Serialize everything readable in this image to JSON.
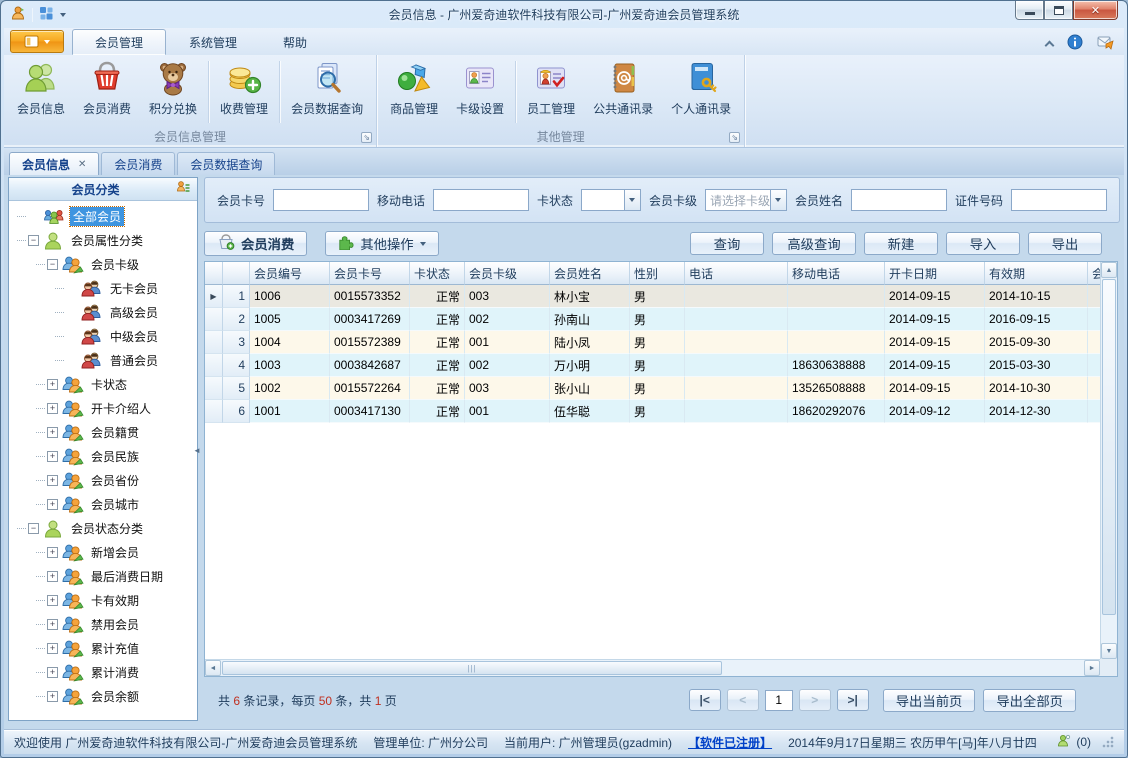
{
  "colors": {
    "accent_orange": "#f7a61f",
    "selection_blue": "#3e95e0",
    "row_cyan": "#e0f4fa",
    "row_cream": "#fdf8ea",
    "row_selected": "#eae8e0",
    "link_blue": "#0040c8",
    "number_red": "#c03020"
  },
  "glyphs": {
    "close": "✕",
    "tab_close": "✕",
    "dropdown": "▼",
    "row_marker": "▶",
    "scroll_left": "◄",
    "scroll_right": "►",
    "scroll_up": "▲",
    "scroll_down": "▼",
    "collapse_sidebar": "◄",
    "plus": "+",
    "minus": "−",
    "launcher": "⇘"
  },
  "title_bar": {
    "title": "会员信息 - 广州爱奇迪软件科技有限公司-广州爱奇迪会员管理系统"
  },
  "ribbon": {
    "tabs": [
      "会员管理",
      "系统管理",
      "帮助"
    ],
    "groups": [
      {
        "label": "会员信息管理",
        "buttons": [
          "会员信息",
          "会员消费",
          "积分兑换",
          "收费管理",
          "会员数据查询"
        ]
      },
      {
        "label": "其他管理",
        "buttons": [
          "商品管理",
          "卡级设置",
          "员工管理",
          "公共通讯录",
          "个人通讯录"
        ]
      }
    ]
  },
  "doc_tabs": [
    "会员信息",
    "会员消费",
    "会员数据查询"
  ],
  "sidebar": {
    "title": "会员分类",
    "tree": [
      {
        "label": "全部会员",
        "level": 0,
        "icon": "group",
        "expander": "none",
        "selected": true
      },
      {
        "label": "会员属性分类",
        "level": 0,
        "icon": "person",
        "expander": "minus"
      },
      {
        "label": "会员卡级",
        "level": 1,
        "icon": "pair_orange",
        "expander": "minus"
      },
      {
        "label": "无卡会员",
        "level": 2,
        "icon": "pair_red",
        "expander": "none"
      },
      {
        "label": "高级会员",
        "level": 2,
        "icon": "pair_red",
        "expander": "none"
      },
      {
        "label": "中级会员",
        "level": 2,
        "icon": "pair_red",
        "expander": "none"
      },
      {
        "label": "普通会员",
        "level": 2,
        "icon": "pair_red",
        "expander": "none"
      },
      {
        "label": "卡状态",
        "level": 1,
        "icon": "pair_orange",
        "expander": "plus"
      },
      {
        "label": "开卡介绍人",
        "level": 1,
        "icon": "pair_orange",
        "expander": "plus"
      },
      {
        "label": "会员籍贯",
        "level": 1,
        "icon": "pair_orange",
        "expander": "plus"
      },
      {
        "label": "会员民族",
        "level": 1,
        "icon": "pair_orange",
        "expander": "plus"
      },
      {
        "label": "会员省份",
        "level": 1,
        "icon": "pair_orange",
        "expander": "plus"
      },
      {
        "label": "会员城市",
        "level": 1,
        "icon": "pair_orange",
        "expander": "plus"
      },
      {
        "label": "会员状态分类",
        "level": 0,
        "icon": "person",
        "expander": "minus"
      },
      {
        "label": "新增会员",
        "level": 1,
        "icon": "pair_orange",
        "expander": "plus"
      },
      {
        "label": "最后消费日期",
        "level": 1,
        "icon": "pair_orange",
        "expander": "plus"
      },
      {
        "label": "卡有效期",
        "level": 1,
        "icon": "pair_orange",
        "expander": "plus"
      },
      {
        "label": "禁用会员",
        "level": 1,
        "icon": "pair_orange",
        "expander": "plus"
      },
      {
        "label": "累计充值",
        "level": 1,
        "icon": "pair_orange",
        "expander": "plus"
      },
      {
        "label": "累计消费",
        "level": 1,
        "icon": "pair_orange",
        "expander": "plus"
      },
      {
        "label": "会员余额",
        "level": 1,
        "icon": "pair_orange",
        "expander": "plus"
      }
    ]
  },
  "filters": {
    "card_no_label": "会员卡号",
    "mobile_label": "移动电话",
    "card_status_label": "卡状态",
    "card_status_value": "",
    "card_level_label": "会员卡级",
    "card_level_value": "请选择卡级",
    "name_label": "会员姓名",
    "id_no_label": "证件号码"
  },
  "actions": {
    "member_consume": "会员消费",
    "other_ops": "其他操作",
    "query": "查询",
    "adv_query": "高级查询",
    "new": "新建",
    "import": "导入",
    "export": "导出"
  },
  "grid": {
    "columns": [
      "会员编号",
      "会员卡号",
      "卡状态",
      "会员卡级",
      "会员姓名",
      "性别",
      "电话",
      "移动电话",
      "开卡日期",
      "有效期",
      "会员"
    ],
    "rows": [
      {
        "num": "1",
        "selected": true,
        "cells": [
          "1006",
          "0015573352",
          "正常",
          "003",
          "林小宝",
          "男",
          "",
          "",
          "2014-09-15",
          "2014-10-15",
          ""
        ]
      },
      {
        "num": "2",
        "selected": false,
        "cells": [
          "1005",
          "0003417269",
          "正常",
          "002",
          "孙南山",
          "男",
          "",
          "",
          "2014-09-15",
          "2016-09-15",
          ""
        ]
      },
      {
        "num": "3",
        "selected": false,
        "cells": [
          "1004",
          "0015572389",
          "正常",
          "001",
          "陆小凤",
          "男",
          "",
          "",
          "2014-09-15",
          "2015-09-30",
          ""
        ]
      },
      {
        "num": "4",
        "selected": false,
        "cells": [
          "1003",
          "0003842687",
          "正常",
          "002",
          "万小明",
          "男",
          "",
          "18630638888",
          "2014-09-15",
          "2015-03-30",
          ""
        ]
      },
      {
        "num": "5",
        "selected": false,
        "cells": [
          "1002",
          "0015572264",
          "正常",
          "003",
          "张小山",
          "男",
          "",
          "13526508888",
          "2014-09-15",
          "2014-10-30",
          ""
        ]
      },
      {
        "num": "6",
        "selected": false,
        "cells": [
          "1001",
          "0003417130",
          "正常",
          "001",
          "伍华聪",
          "男",
          "",
          "18620292076",
          "2014-09-12",
          "2014-12-30",
          ""
        ]
      }
    ]
  },
  "pagination": {
    "summary": [
      "共 ",
      "6",
      " 条记录，每页 ",
      "50",
      " 条，共 ",
      "1",
      " 页"
    ],
    "first": "|<",
    "prev": "<",
    "page": "1",
    "next": ">",
    "last": ">|",
    "export_current": "导出当前页",
    "export_all": "导出全部页"
  },
  "status_bar": {
    "welcome": "欢迎使用 广州爱奇迪软件科技有限公司-广州爱奇迪会员管理系统",
    "org": "管理单位: 广州分公司",
    "user": "当前用户: 广州管理员(gzadmin)",
    "registered": "【软件已注册】",
    "date": "2014年9月17日星期三 农历甲午[马]年八月廿四",
    "online_count": "(0)"
  }
}
